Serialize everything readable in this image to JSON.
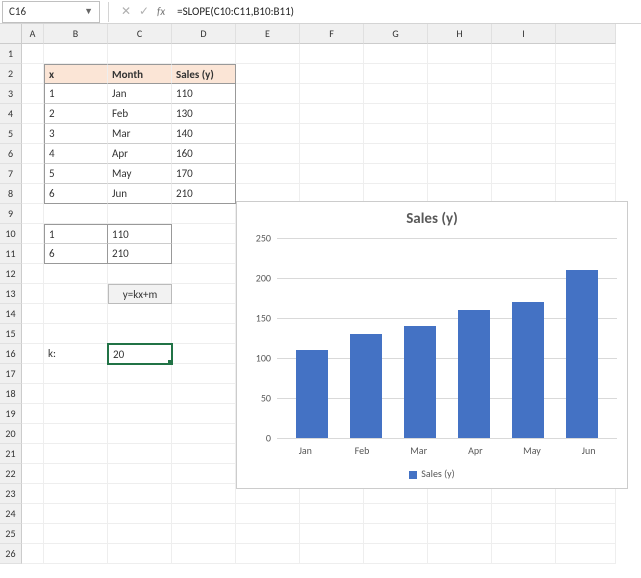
{
  "formula_bar": {
    "cell_ref": "C16",
    "formula": "=SLOPE(C10:C11,B10:B11)"
  },
  "col_headers": [
    "A",
    "B",
    "C",
    "D",
    "E",
    "F",
    "G",
    "H",
    "I"
  ],
  "row_headers": [
    "1",
    "2",
    "3",
    "4",
    "5",
    "6",
    "7",
    "8",
    "9",
    "10",
    "11",
    "12",
    "13",
    "14",
    "15",
    "16",
    "17",
    "18",
    "19",
    "20",
    "21",
    "22",
    "23",
    "24",
    "25",
    "26"
  ],
  "table": {
    "headers": [
      "x",
      "Month",
      "Sales (y)"
    ],
    "rows": [
      [
        "1",
        "Jan",
        "110"
      ],
      [
        "2",
        "Feb",
        "130"
      ],
      [
        "3",
        "Mar",
        "140"
      ],
      [
        "4",
        "Apr",
        "160"
      ],
      [
        "5",
        "May",
        "170"
      ],
      [
        "6",
        "Jun",
        "210"
      ]
    ]
  },
  "block2": {
    "r1": [
      "1",
      "110"
    ],
    "r2": [
      "6",
      "210"
    ]
  },
  "eq_label": "y=kx+m",
  "k_label": "k:",
  "k_value": "20",
  "chart_data": {
    "type": "bar",
    "title": "Sales (y)",
    "categories": [
      "Jan",
      "Feb",
      "Mar",
      "Apr",
      "May",
      "Jun"
    ],
    "values": [
      110,
      130,
      140,
      160,
      170,
      210
    ],
    "series_name": "Sales (y)",
    "ylim": [
      0,
      250
    ],
    "yticks": [
      0,
      50,
      100,
      150,
      200,
      250
    ],
    "xlabel": "",
    "ylabel": ""
  }
}
